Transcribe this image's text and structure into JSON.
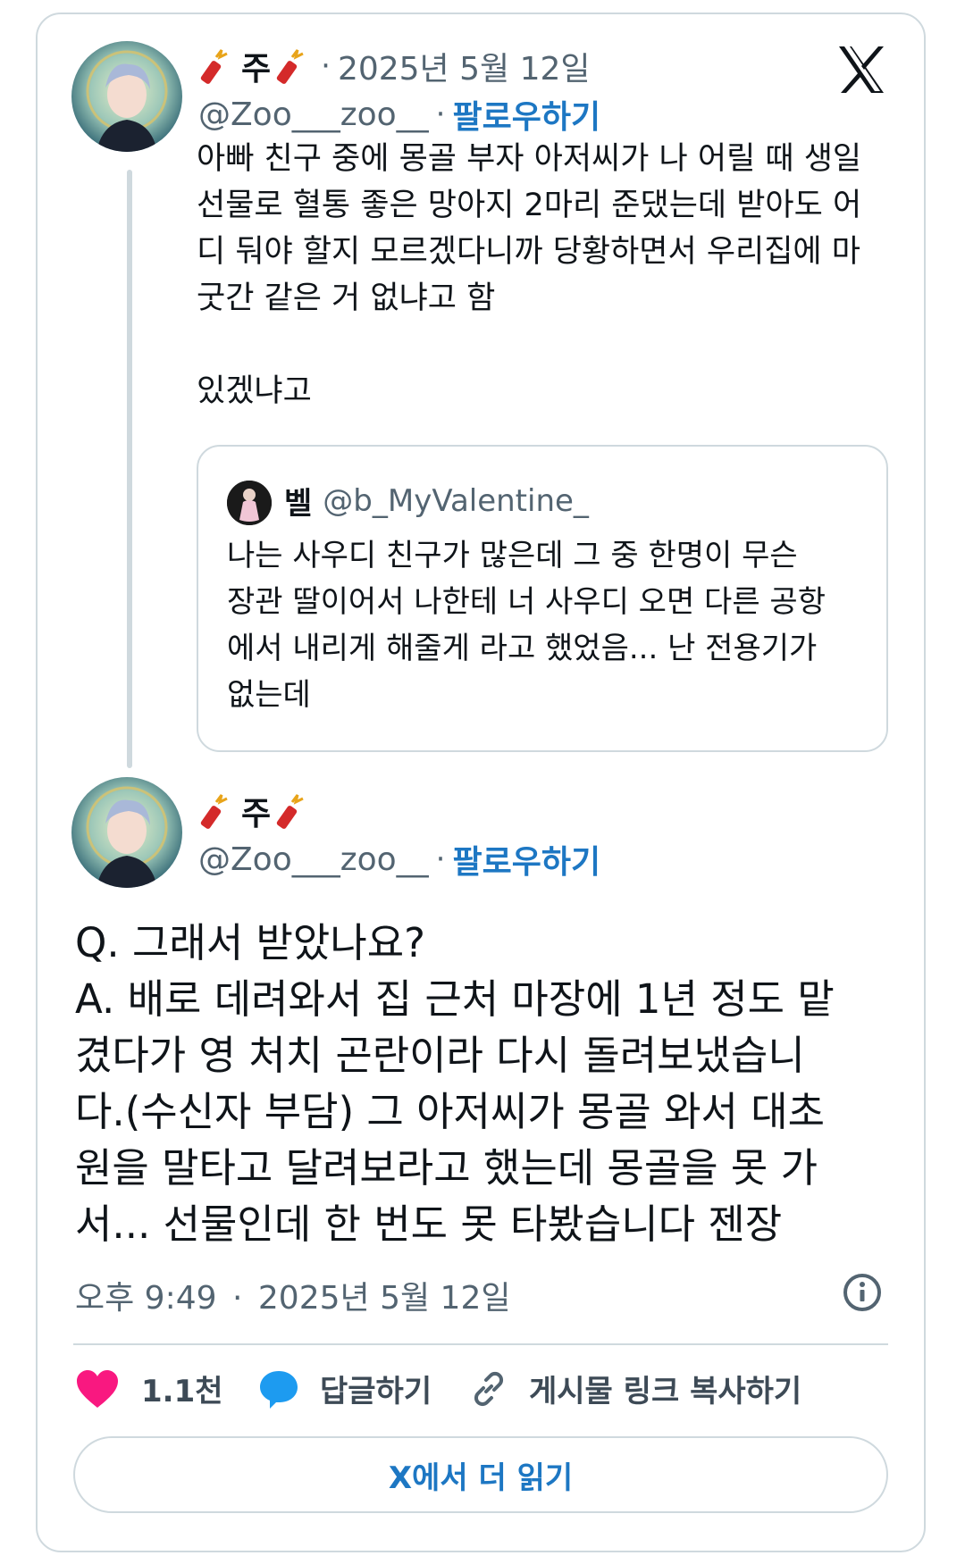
{
  "tweet1": {
    "name": "주",
    "date": "2025년 5월 12일",
    "handle": "@Zoo___zoo__",
    "follow_label": "팔로우하기",
    "text_lines": [
      "아빠 친구 중에 몽골 부자 아저씨가 나 어릴 때 생일",
      "선물로 혈통 좋은 망아지 2마리 준댔는데 받아도 어",
      "디 둬야 할지 모르겠다니까 당황하면서 우리집에 마",
      "굿간 같은 거 없냐고 함",
      "",
      "있겠냐고"
    ]
  },
  "quote": {
    "name": "벨",
    "handle": "@b_MyValentine_",
    "text_lines": [
      "나는 사우디 친구가 많은데 그 중 한명이 무슨",
      "장관 딸이어서 나한테 너 사우디 오면 다른 공항",
      "에서 내리게 해줄게 라고 했었음... 난 전용기가",
      "없는데"
    ]
  },
  "tweet2": {
    "name": "주",
    "handle": "@Zoo___zoo__",
    "follow_label": "팔로우하기",
    "text_lines": [
      "Q. 그래서 받았나요?",
      "A. 배로 데려와서 집 근처 마장에 1년 정도 맡",
      "겼다가 영 처치 곤란이라 다시 돌려보냈습니",
      "다.(수신자 부담) 그 아저씨가 몽골 와서 대초",
      "원을 말타고 달려보라고 했는데 몽골을 못 가",
      "서... 선물인데 한 번도 못 타봤습니다 젠장"
    ],
    "time": "오후 9:49",
    "date": "2025년 5월 12일"
  },
  "actions": {
    "like_count": "1.1천",
    "reply_label": "답글하기",
    "copy_link_label": "게시물 링크 복사하기"
  },
  "read_more_label": "X에서 더 읽기",
  "separator": "·",
  "icons": {
    "like": "heart-icon",
    "reply": "speech-bubble-icon",
    "copy": "link-icon",
    "info": "info-icon",
    "logo": "x-logo-icon",
    "emoji": "firecracker-emoji"
  },
  "colors": {
    "follow": "#1d77c3",
    "heart": "#f91880",
    "reply": "#1d9bf0",
    "border": "#cfd9de",
    "muted": "#536471"
  }
}
